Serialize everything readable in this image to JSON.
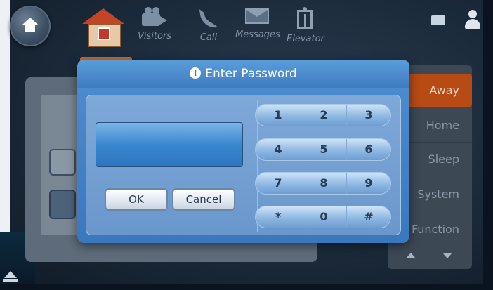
{
  "nav": {
    "items": [
      {
        "label": "Visitors",
        "icon": "camera-icon"
      },
      {
        "label": "Call",
        "icon": "phone-icon"
      },
      {
        "label": "Messages",
        "icon": "envelope-icon"
      },
      {
        "label": "Elevator",
        "icon": "elevator-icon"
      }
    ]
  },
  "menu": {
    "items": [
      {
        "label": "Away",
        "active": true
      },
      {
        "label": "Home",
        "active": false
      },
      {
        "label": "Sleep",
        "active": false
      },
      {
        "label": "System",
        "active": false
      },
      {
        "label": "Function",
        "active": false
      }
    ]
  },
  "dialog": {
    "title": "Enter Password",
    "password_value": "",
    "ok_label": "OK",
    "cancel_label": "Cancel",
    "keypad": [
      [
        "1",
        "2",
        "3"
      ],
      [
        "4",
        "5",
        "6"
      ],
      [
        "7",
        "8",
        "9"
      ],
      [
        "*",
        "0",
        "#"
      ]
    ]
  },
  "colors": {
    "dialog_accent": "#3f7cc2",
    "menu_active": "#b84b14"
  }
}
